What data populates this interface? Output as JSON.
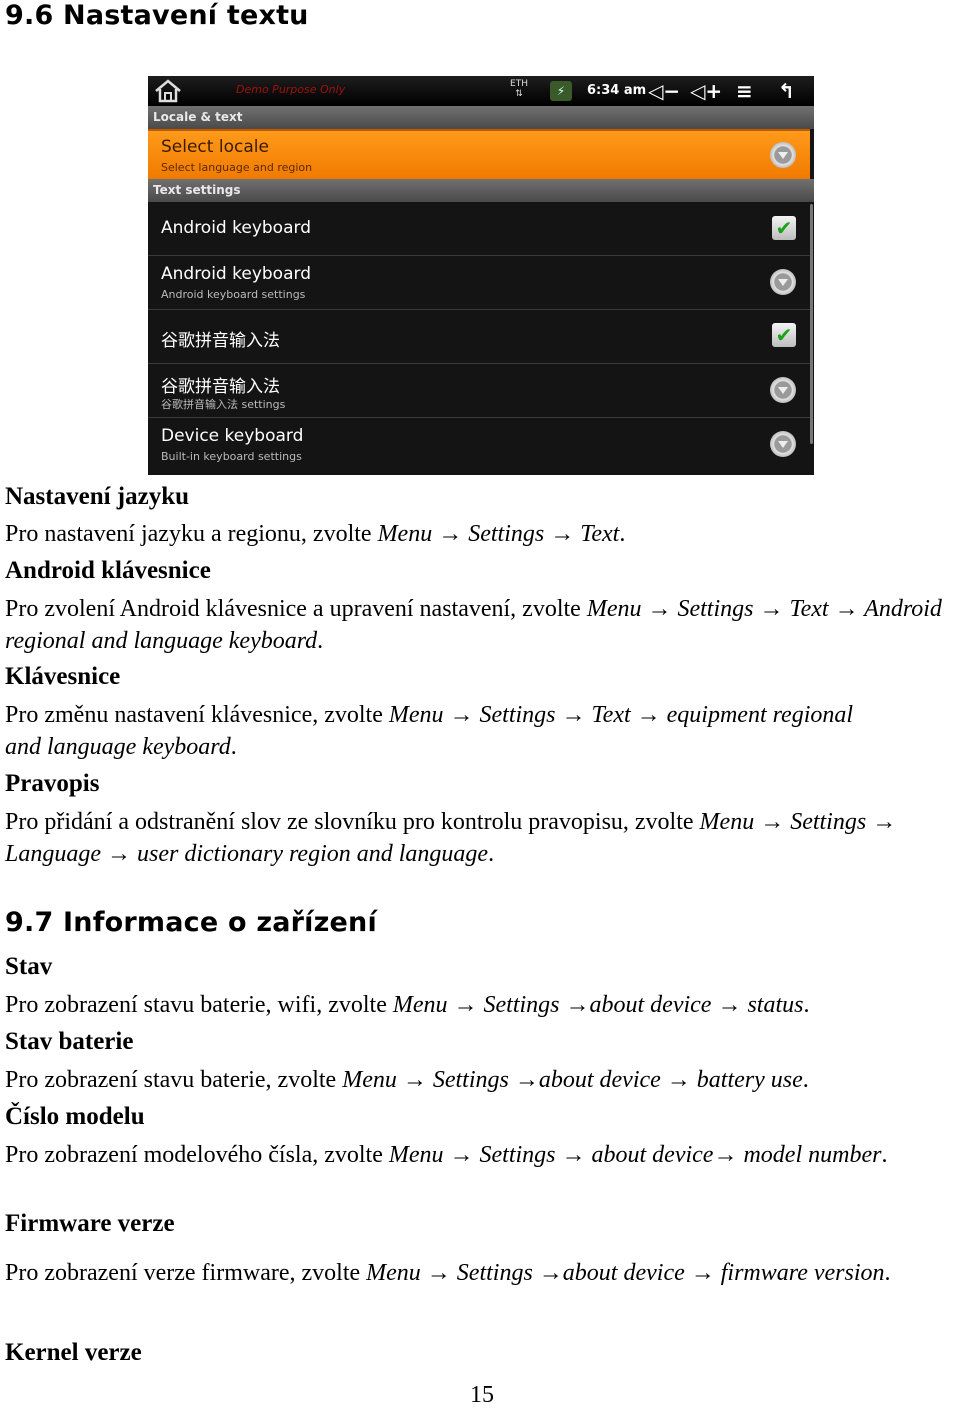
{
  "section_96": {
    "title": "9.6 Nastavení textu"
  },
  "screenshot": {
    "statusbar": {
      "watermark": "Demo Purpose Only",
      "network_label": "ETH",
      "network_arrows": "⇅",
      "battery_symbol": "⚡",
      "time": "6:34 am",
      "volume_down": "◁−",
      "volume_up": "◁+",
      "menu": "≡",
      "back": "↰"
    },
    "categories": {
      "locale": "Locale & text",
      "text": "Text settings"
    },
    "items": [
      {
        "title": "Select locale",
        "summary": "Select language and region",
        "widget": "more",
        "selected": true
      },
      {
        "title": "Android keyboard",
        "summary": "",
        "widget": "checkbox",
        "checked": true
      },
      {
        "title": "Android keyboard",
        "summary": "Android keyboard settings",
        "widget": "more"
      },
      {
        "title": "谷歌拼音输入法",
        "summary": "",
        "widget": "checkbox",
        "checked": true
      },
      {
        "title": "谷歌拼音输入法",
        "summary": "谷歌拼音输入法 settings",
        "widget": "more"
      },
      {
        "title": "Device keyboard",
        "summary": "Built-in keyboard settings",
        "widget": "more"
      }
    ],
    "check_glyph": "✔"
  },
  "doc": {
    "nastaveni_jazyku": {
      "heading": "Nastavení jazyku",
      "text": "Pro nastavení jazyku a regionu, zvolte ",
      "path": "Menu → Settings → Text",
      "end": "."
    },
    "android_klavesnice": {
      "heading": "Android klávesnice",
      "text": "Pro zvolení Android klávesnice a upravení nastavení, zvolte ",
      "path": "Menu → Settings → Text → Android regional and language keyboard",
      "end": "."
    },
    "klavesnice": {
      "heading": "Klávesnice",
      "text": "Pro změnu nastavení klávesnice, zvolte ",
      "path": "Menu → Settings → Text → equipment regional and language keyboard",
      "end": "."
    },
    "pravopis": {
      "heading": "Pravopis",
      "text": "Pro přidání a odstranění slov ze slovníku pro kontrolu pravopisu, zvolte ",
      "path": "Menu → Settings → Language → user dictionary region and language",
      "end": "."
    }
  },
  "section_97": {
    "title": "9.7 Informace o zařízení",
    "stav": {
      "heading": "Stav",
      "text": "Pro zobrazení stavu baterie, wifi, zvolte ",
      "path": "Menu → Settings →about device → status",
      "end": "."
    },
    "stav_baterie": {
      "heading": "Stav baterie",
      "text": "Pro zobrazení stavu baterie, zvolte ",
      "path": "Menu → Settings →about device → battery use",
      "end": "."
    },
    "cislo_modelu": {
      "heading": "Číslo modelu",
      "text": "Pro zobrazení modelového čísla, zvolte ",
      "path": "Menu → Settings → about device→ model number",
      "end": "."
    },
    "firmware": {
      "heading": "Firmware verze",
      "text": "Pro zobrazení verze firmware, zvolte ",
      "path": "Menu → Settings →about device → firmware version",
      "end": "."
    },
    "kernel": {
      "heading": "Kernel verze"
    }
  },
  "page_number": "15"
}
